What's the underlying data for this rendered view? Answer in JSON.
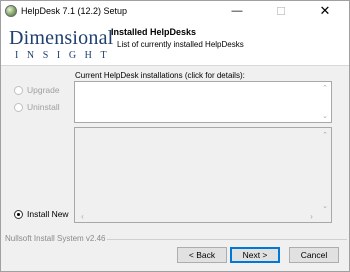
{
  "window": {
    "title": "HelpDesk 7.1 (12.2) Setup"
  },
  "header": {
    "logo_top": "Dimensional",
    "logo_bottom": "INSIGHT",
    "title": "Installed HelpDesks",
    "subtitle": "List of currently installed HelpDesks"
  },
  "options": {
    "upgrade": "Upgrade",
    "uninstall": "Uninstall",
    "install_new": "Install New",
    "selected": "install_new"
  },
  "list": {
    "label": "Current HelpDesk installations (click for details):",
    "items": []
  },
  "footer": {
    "branding": "Nullsoft Install System v2.46",
    "back": "< Back",
    "next": "Next >",
    "cancel": "Cancel"
  },
  "colors": {
    "logo": "#1f3f6e",
    "focus": "#0078d7"
  }
}
